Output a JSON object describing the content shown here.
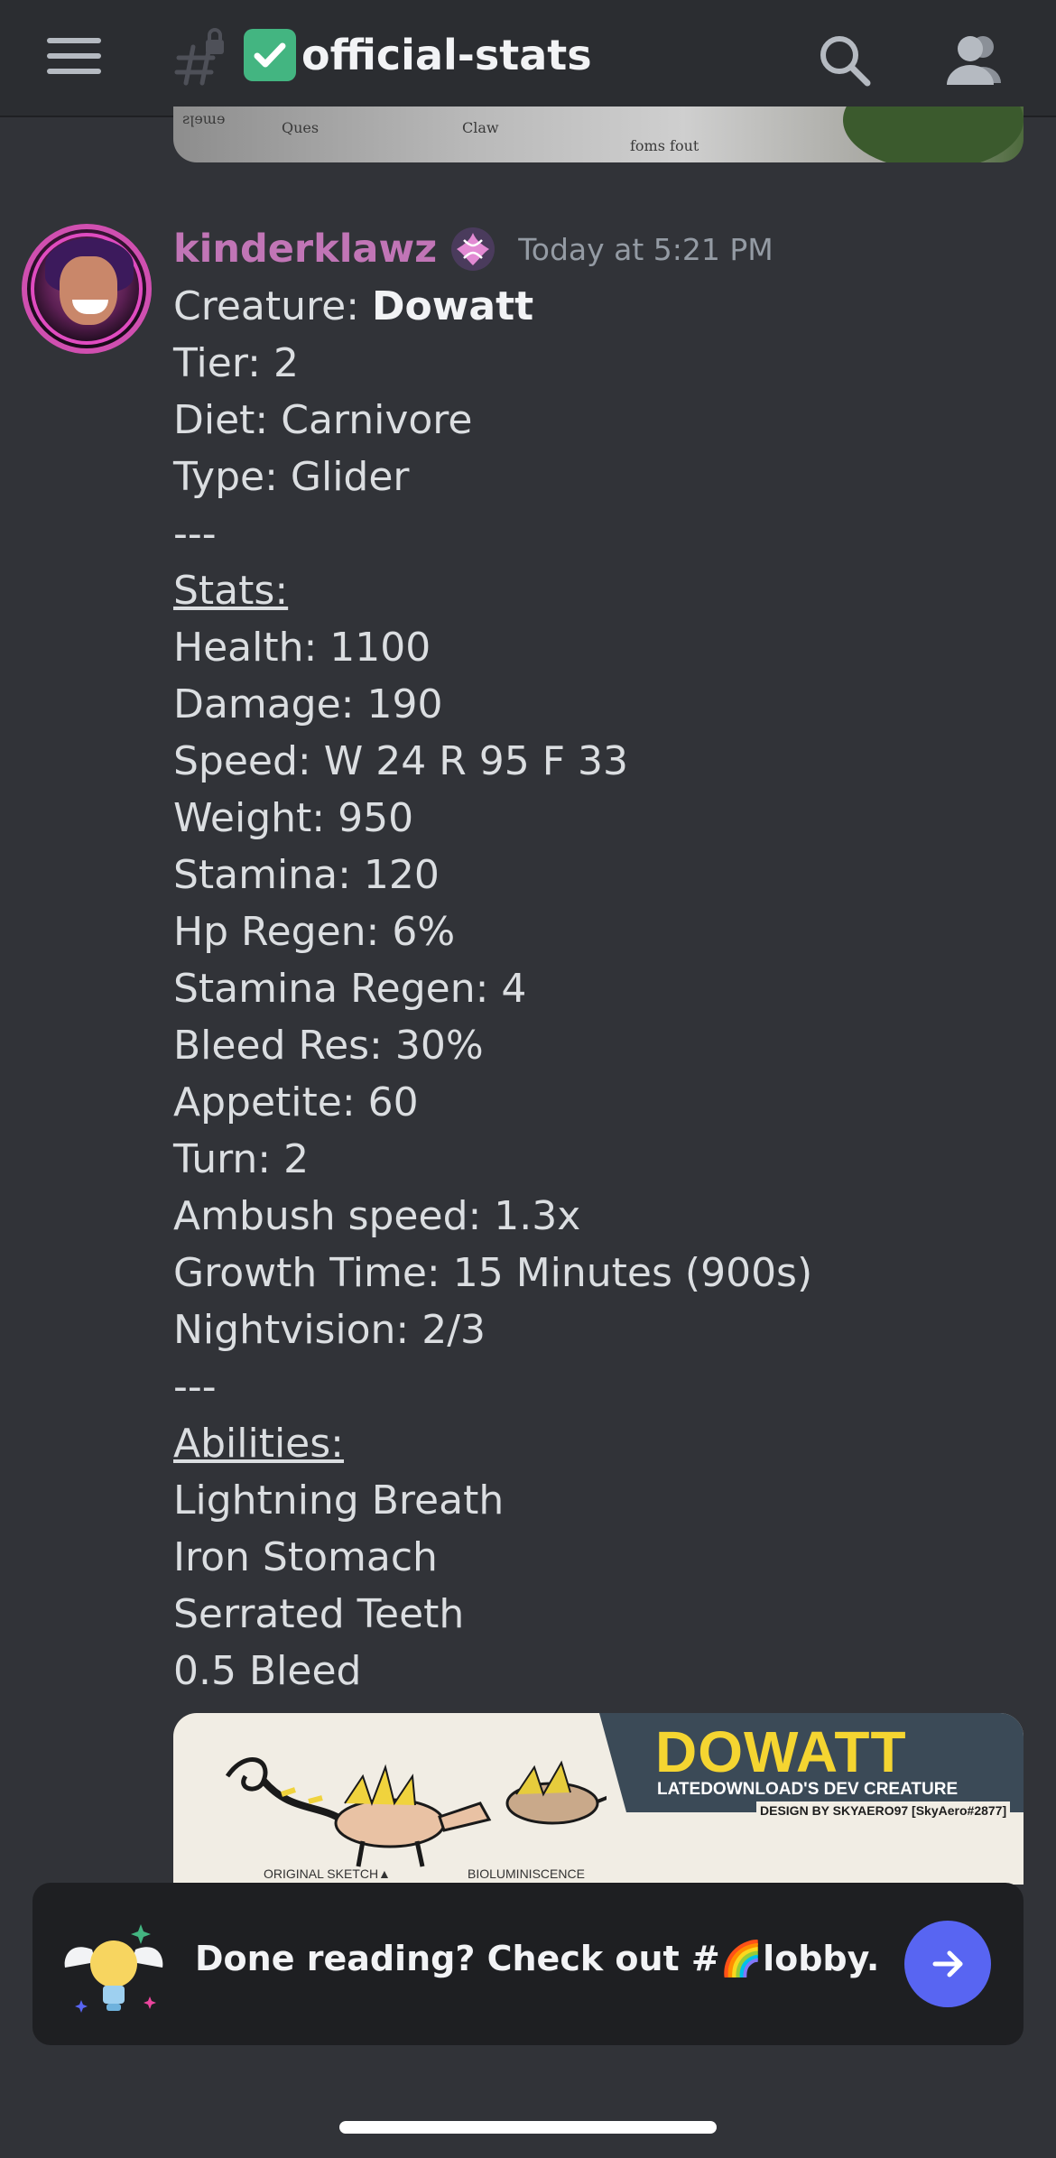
{
  "header": {
    "channel_name": "official-stats",
    "channel_emoji": "check-mark-button-emoji"
  },
  "previous_embed": {
    "sketch_labels": [
      "Ques",
      "Claw",
      "foms fout"
    ]
  },
  "message": {
    "username": "kinderklawz",
    "timestamp": "Today at 5:21 PM",
    "lines": [
      {
        "label": "Creature: ",
        "value": "Dowatt"
      },
      {
        "text": "Tier: 2"
      },
      {
        "text": "Diet: Carnivore"
      },
      {
        "text": "Type: Glider"
      },
      {
        "text": "---"
      },
      {
        "heading": "Stats:"
      },
      {
        "text": "Health: 1100"
      },
      {
        "text": "Damage: 190"
      },
      {
        "text": "Speed: W 24 R 95 F 33"
      },
      {
        "text": "Weight: 950"
      },
      {
        "text": "Stamina: 120"
      },
      {
        "text": "Hp Regen: 6%"
      },
      {
        "text": "Stamina Regen: 4"
      },
      {
        "text": "Bleed Res: 30%"
      },
      {
        "text": "Appetite: 60"
      },
      {
        "text": "Turn: 2"
      },
      {
        "text": "Ambush speed: 1.3x"
      },
      {
        "text": "Growth Time: 15 Minutes (900s)"
      },
      {
        "text": "Nightvision: 2/3"
      },
      {
        "text": "---"
      },
      {
        "heading": "Abilities:"
      },
      {
        "text": "Lightning Breath"
      },
      {
        "text": "Iron Stomach"
      },
      {
        "text": "Serrated Teeth"
      },
      {
        "text": "0.5 Bleed"
      }
    ]
  },
  "image_embed": {
    "title": "DOWATT",
    "subtitle": "LATEDOWNLOAD'S DEV CREATURE",
    "credit": "DESIGN BY SKYAERO97 [SkyAero#2877]",
    "caption_left": "ORIGINAL SKETCH▲",
    "caption_mid": "BIOLUMINISCENCE"
  },
  "done_reading": {
    "text_prefix": "Done reading? Check out #",
    "channel_emoji": "🌈",
    "channel": "lobby.",
    "icon": "winged-lightbulb-icon"
  },
  "colors": {
    "background": "#313338",
    "header": "#2b2d31",
    "username": "#c175b6",
    "accent_button": "#5865f2"
  }
}
